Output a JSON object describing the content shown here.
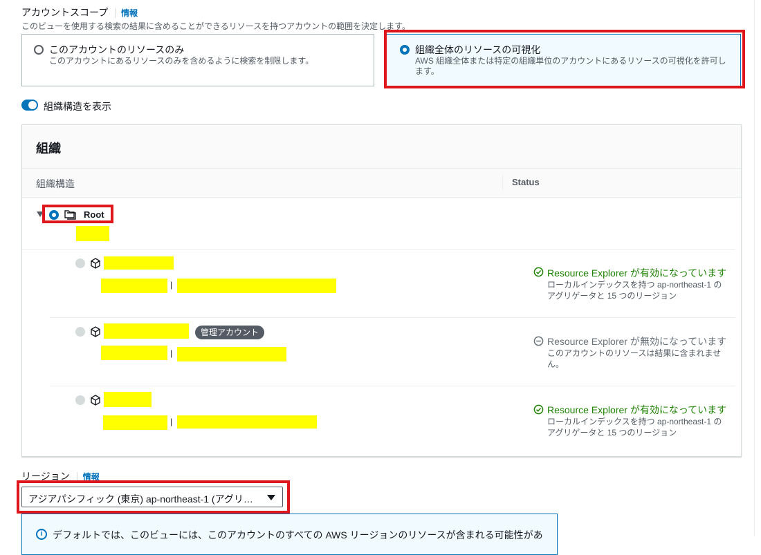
{
  "account_scope": {
    "label": "アカウントスコープ",
    "info_link": "情報",
    "description": "このビューを使用する検索の結果に含めることができるリソースを持つアカウントの範囲を決定します。",
    "options": [
      {
        "title": "このアカウントのリソースのみ",
        "description": "このアカウントにあるリソースのみを含めるように検索を制限します。",
        "selected": false
      },
      {
        "title": "組織全体のリソースの可視化",
        "description_line1": "AWS 組織全体または特定の組織単位のアカウントにあるリソースの可視化を許可し",
        "description_line2": "ます。",
        "selected": true
      }
    ]
  },
  "toggle": {
    "label": "組織構造を表示",
    "on": true
  },
  "organization": {
    "title": "組織",
    "columns": {
      "structure": "組織構造",
      "status": "Status"
    },
    "root_label": "Root",
    "accounts": [
      {
        "badge": "",
        "status_icon": "check-circle-icon",
        "status_kind": "enabled",
        "status_title": "Resource Explorer が有効になっています",
        "status_line1": "ローカルインデックスを持つ ap-northeast-1 の",
        "status_line2": "アグリゲータと 15 つのリージョン"
      },
      {
        "badge": "管理アカウント",
        "status_icon": "minus-circle-icon",
        "status_kind": "disabled",
        "status_title": "Resource Explorer が無効になっています",
        "status_line1": "このアカウントのリソースは結果に含まれませ",
        "status_line2": "ん。"
      },
      {
        "badge": "",
        "status_icon": "check-circle-icon",
        "status_kind": "enabled",
        "status_title": "Resource Explorer が有効になっています",
        "status_line1": "ローカルインデックスを持つ ap-northeast-1 の",
        "status_line2": "アグリゲータと 15 つのリージョン"
      }
    ]
  },
  "region": {
    "label": "リージョン",
    "info_link": "情報",
    "selected": "アジアパシフィック (東京) ap-northeast-1 (アグリ…"
  },
  "alert": {
    "icon": "info-icon",
    "text": "デフォルトでは、このビューには、このアカウントのすべての AWS リージョンのリソースが含まれる可能性があ"
  },
  "colors": {
    "accent": "#0073bb",
    "highlight": "#e0161d",
    "success": "#1d8102",
    "redaction": "#ffff00"
  }
}
